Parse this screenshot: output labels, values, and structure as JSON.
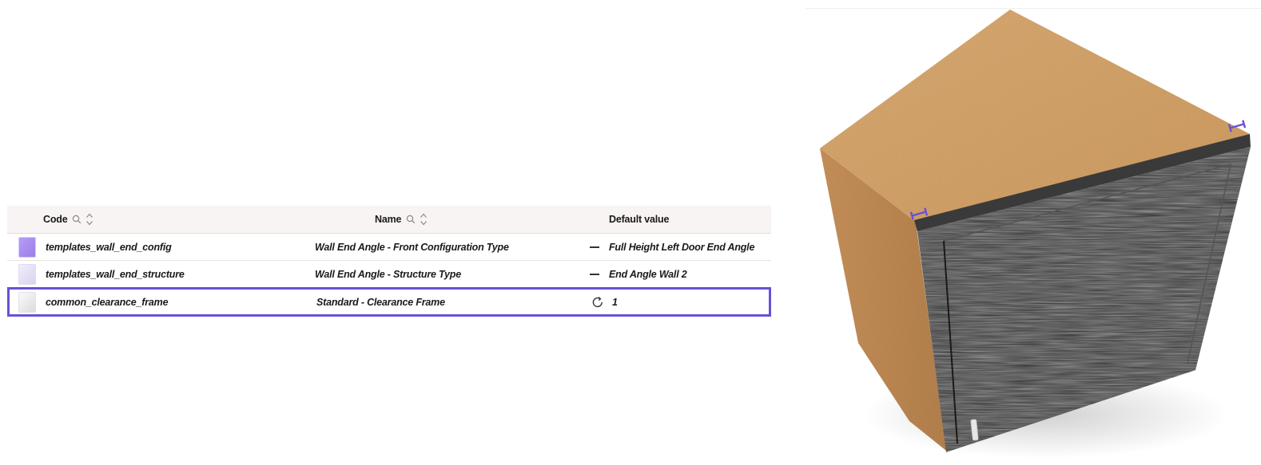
{
  "table": {
    "columns": {
      "code": "Code",
      "name": "Name",
      "default_value": "Default value"
    },
    "rows": [
      {
        "code": "templates_wall_end_config",
        "name": "Wall End Angle - Front Configuration Type",
        "value_icon": "dash-icon",
        "default_value": "Full Height Left Door End Angle",
        "thumb": "purple"
      },
      {
        "code": "templates_wall_end_structure",
        "name": "Wall End Angle - Structure Type",
        "value_icon": "dash-icon",
        "default_value": "End Angle Wall 2",
        "thumb": "lilac"
      },
      {
        "code": "common_clearance_frame",
        "name": "Standard - Clearance Frame",
        "value_icon": "reset-icon",
        "default_value": "1",
        "thumb": "white",
        "selected": true
      }
    ]
  },
  "colors": {
    "accent": "#6b4fd8",
    "header_bg": "#f8f4f3",
    "cabinet_wood": "#d7a266",
    "door_black": "#2a2a2a"
  },
  "icons": {
    "search": "search-icon",
    "sort": "sort-icon",
    "dimension_marker": "dimension-marker-icon"
  }
}
